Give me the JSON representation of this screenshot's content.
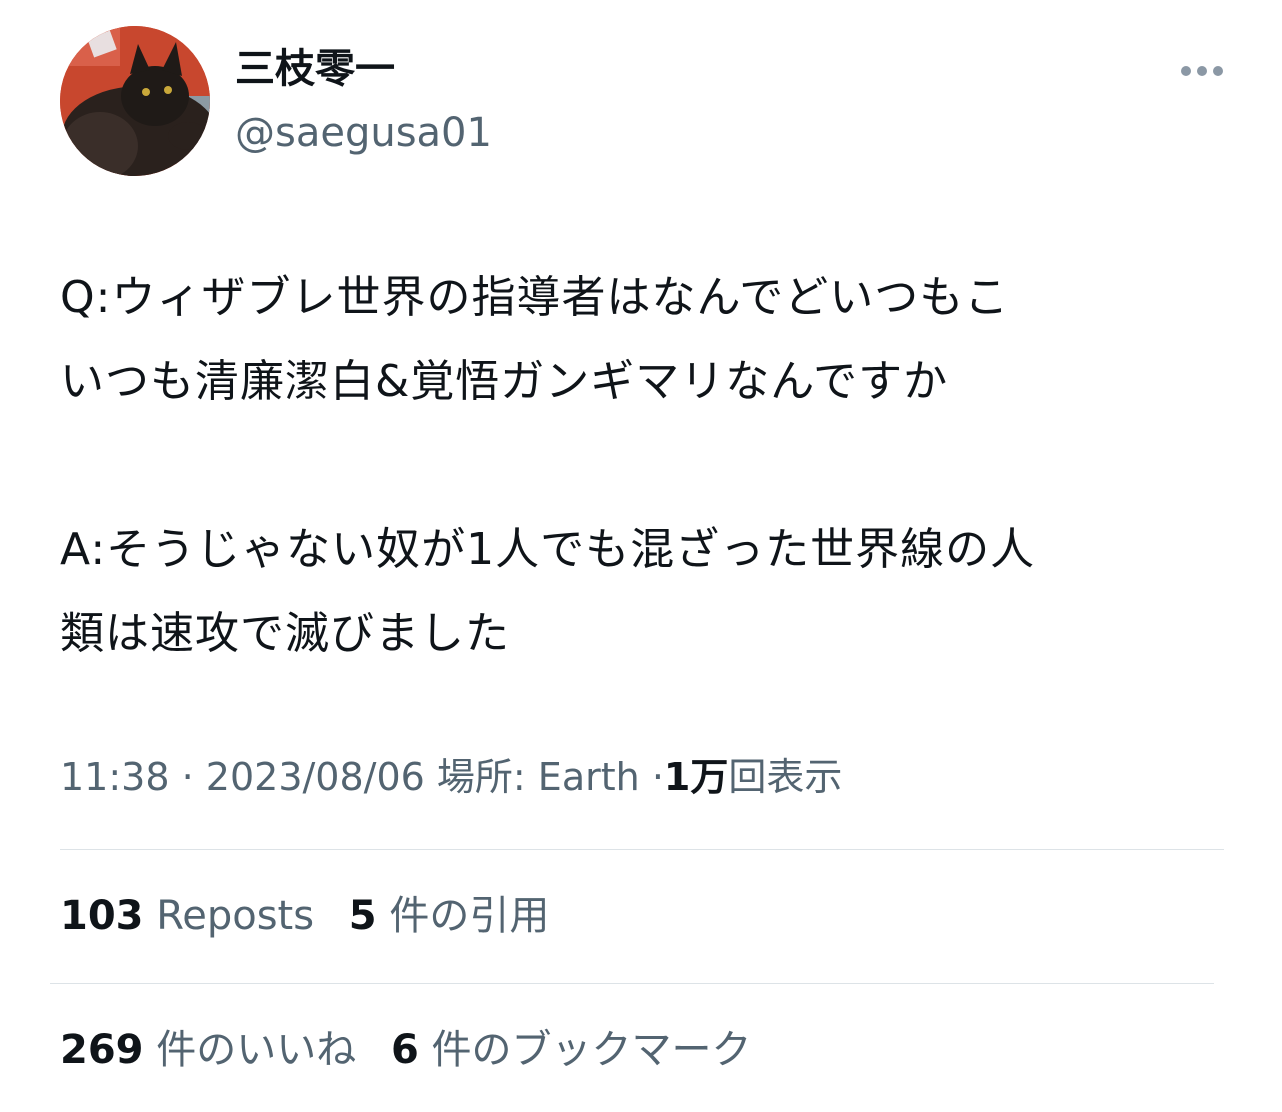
{
  "author": {
    "display_name": "三枝零一",
    "handle": "@saegusa01",
    "avatar": "black-cat-photo"
  },
  "more_icon": "more-horizontal-icon",
  "tweet": {
    "text": "Q:ウィザブレ世界の指導者はなんでどいつもこ\nいつも清廉潔白&覚悟ガンギマリなんですか\n\nA:そうじゃない奴が1人でも混ざった世界線の人\n類は速攻で滅びました"
  },
  "meta": {
    "time": "11:38",
    "separator": "·",
    "date": "2023/08/06",
    "location_label": "場所: Earth",
    "views_count": "1万",
    "views_label": "回表示"
  },
  "stats": {
    "reposts_count": "103",
    "reposts_label": "Reposts",
    "quotes_count": "5",
    "quotes_label": "件の引用",
    "likes_count": "269",
    "likes_label": "件のいいね",
    "bookmarks_count": "6",
    "bookmarks_label": "件のブックマーク"
  },
  "colors": {
    "text_primary": "#0f1419",
    "text_secondary": "#536471",
    "divider": "#dde3e7"
  }
}
